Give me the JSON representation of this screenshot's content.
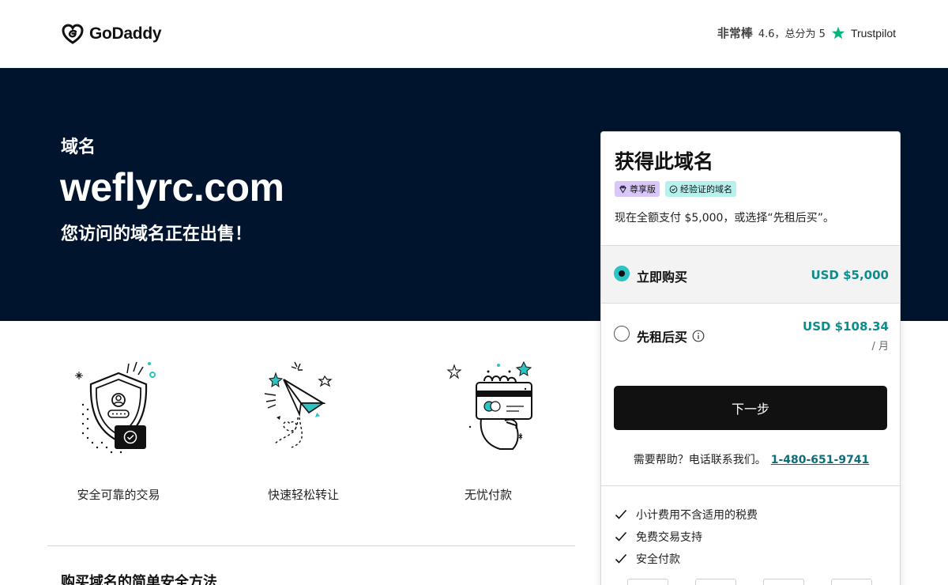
{
  "header": {
    "logo_text": "GoDaddy",
    "rating_word": "非常棒",
    "rating_text": "4.6，总分为 5",
    "trustpilot": "Trustpilot"
  },
  "hero": {
    "category": "域名",
    "domain": "weflyrc.com",
    "subtitle": "您访问的域名正在出售！"
  },
  "features": [
    {
      "caption": "安全可靠的交易",
      "icon": "shield-icon"
    },
    {
      "caption": "快速轻松转让",
      "icon": "paper-plane-icon"
    },
    {
      "caption": "无忧付款",
      "icon": "card-payment-icon"
    }
  ],
  "how_title": "购买域名的简单安全方法",
  "card": {
    "title": "获得此域名",
    "badge_premium": "尊享版",
    "badge_verified": "经验证的域名",
    "description": "现在全额支付 $5,000，或选择“先租后买”。",
    "options": {
      "buy": {
        "label": "立即购买",
        "price": "USD $5,000",
        "selected": true
      },
      "lease": {
        "label": "先租后买",
        "price": "USD $108.34",
        "per": "/ 月",
        "selected": false
      }
    },
    "next_label": "下一步",
    "help_text": "需要帮助？电话联系我们。",
    "phone": "1-480-651-9741",
    "checks": [
      "小计费用不含适用的税费",
      "免费交易支持",
      "安全付款"
    ]
  },
  "colors": {
    "hero_bg": "#00142e",
    "accent_teal": "#2bc4c3",
    "price_teal": "#0d8c8c",
    "button_bg": "#111111",
    "trustpilot_star": "#00b67a"
  }
}
